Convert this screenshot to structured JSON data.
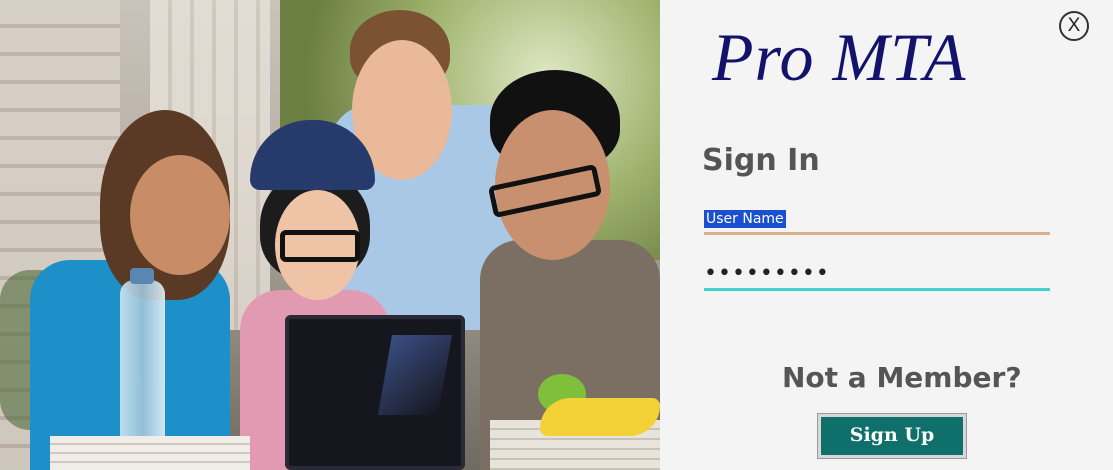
{
  "app": {
    "logo_text": "Pro MTA",
    "close_label": "X"
  },
  "signin": {
    "title": "Sign In",
    "username_value": "User Name",
    "password_value": "•••••••••"
  },
  "signup": {
    "prompt": "Not a Member?",
    "button_label": "Sign Up"
  },
  "colors": {
    "logo": "#13136b",
    "username_underline": "#d9b08c",
    "password_underline": "#41d3cb",
    "signup_button": "#0e6f6b"
  },
  "icons": {
    "close": "close-icon"
  }
}
